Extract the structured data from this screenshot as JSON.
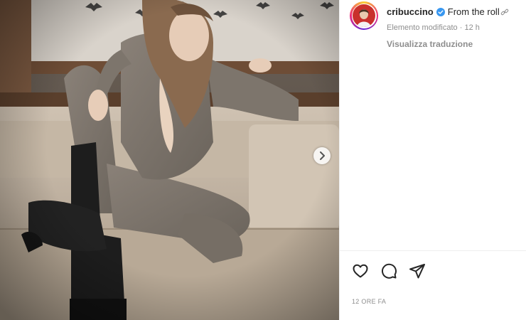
{
  "post": {
    "username": "cribuccino",
    "caption": "From the roll",
    "caption_link_glyph": "link-icon",
    "edited_label": "Elemento modificato",
    "separator": "·",
    "edited_time": "12 h",
    "translate_label": "Visualizza traduzione",
    "timestamp": "12 ORE FA"
  },
  "icons": {
    "verified": "verified-badge-icon",
    "next": "chevron-right-icon",
    "like": "heart-icon",
    "comment": "comment-icon",
    "share": "send-icon"
  },
  "colors": {
    "verified": "#3897f0",
    "text_primary": "#262626",
    "text_secondary": "#8e8e8e",
    "divider": "#efefef"
  }
}
